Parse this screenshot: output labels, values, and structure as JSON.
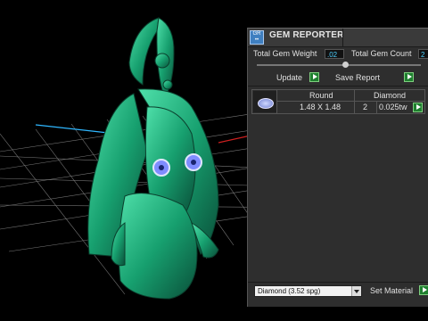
{
  "app": {
    "title": "GEM REPORTER"
  },
  "stats": {
    "weight_label": "Total Gem Weight",
    "weight_value": ".02",
    "count_label": "Total Gem Count",
    "count_value": "2"
  },
  "actions": {
    "update_label": "Update",
    "save_label": "Save Report"
  },
  "table": {
    "shape": "Round",
    "material": "Diamond",
    "size": "1.48 X 1.48",
    "count": "2",
    "weight": "0.025tw"
  },
  "material": {
    "selected": "Diamond      (3.52 spg)",
    "set_label": "Set Material"
  },
  "colors": {
    "panel_bg": "#2e2e2e",
    "value_cyan": "#4fd1ff",
    "button_green": "#1f7f2f",
    "model_green": "#1fa37a"
  },
  "icons": {
    "logo": "gem-reporter-logo-icon",
    "play": "play-arrow-icon",
    "gem": "round-gem-icon",
    "dropdown": "chevron-down-icon"
  }
}
